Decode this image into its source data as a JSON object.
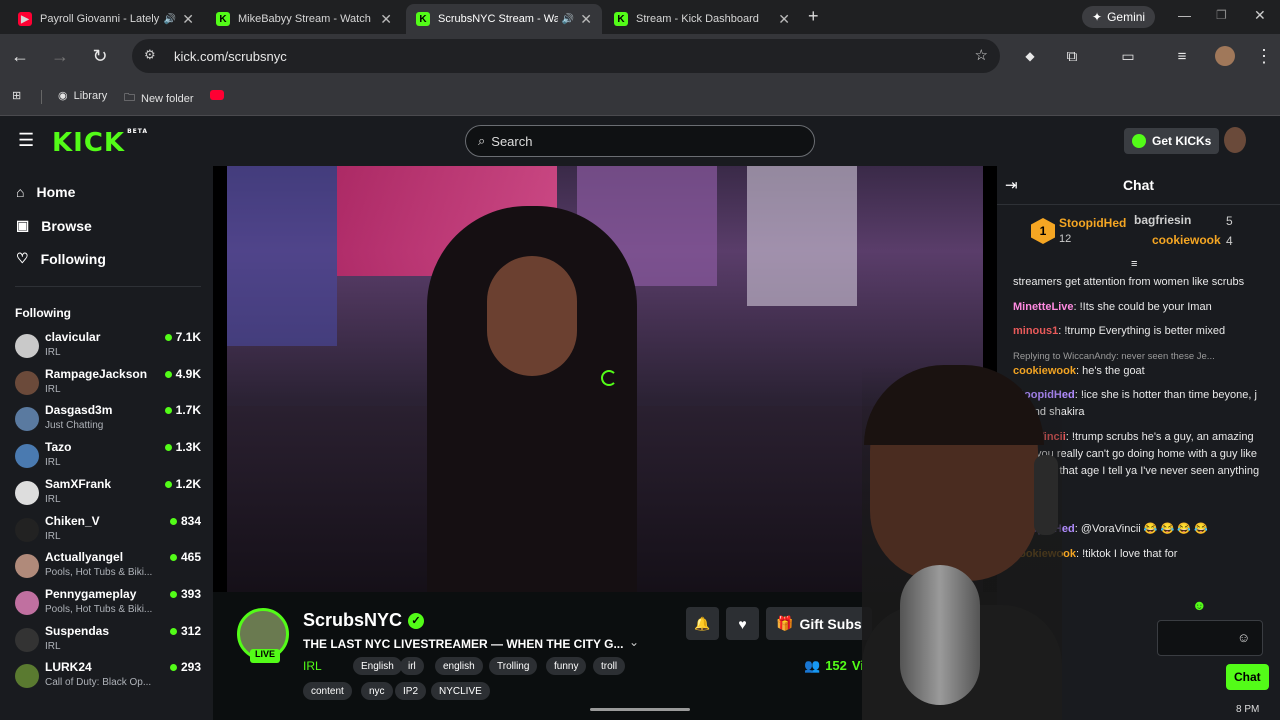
{
  "browser": {
    "tabs": [
      {
        "title": "Payroll Giovanni - Lately",
        "audio": true,
        "favicon_color": "#ff0033"
      },
      {
        "title": "MikeBabyy Stream - Watch L",
        "audio": false,
        "favicon_color": "#53fc18"
      },
      {
        "title": "ScrubsNYC Stream - Wat",
        "audio": true,
        "favicon_color": "#53fc18"
      },
      {
        "title": "Stream - Kick Dashboard",
        "audio": false,
        "favicon_color": "#53fc18"
      }
    ],
    "new_tab": "+",
    "gemini": "Gemini",
    "url": "kick.com/scrubsnyc",
    "bookmarks": [
      "Library",
      "New folder"
    ]
  },
  "kick": {
    "logo": "KICK",
    "logo_badge": "BETA",
    "search_placeholder": "Search",
    "get_kicks": "Get KICKs",
    "nav": [
      "Home",
      "Browse",
      "Following"
    ],
    "following_heading": "Following",
    "following": [
      {
        "name": "clavicular",
        "category": "IRL",
        "viewers": "7.1K",
        "avatar": "#c9c9c9"
      },
      {
        "name": "RampageJackson",
        "category": "IRL",
        "viewers": "4.9K",
        "avatar": "#6b4a3a"
      },
      {
        "name": "Dasgasd3m",
        "category": "Just Chatting",
        "viewers": "1.7K",
        "avatar": "#5a7aa0"
      },
      {
        "name": "Tazo",
        "category": "IRL",
        "viewers": "1.3K",
        "avatar": "#4a7ab0"
      },
      {
        "name": "SamXFrank",
        "category": "IRL",
        "viewers": "1.2K",
        "avatar": "#dddddd"
      },
      {
        "name": "Chiken_V",
        "category": "IRL",
        "viewers": "834",
        "avatar": "#222222"
      },
      {
        "name": "Actuallyangel",
        "category": "Pools, Hot Tubs & Biki...",
        "viewers": "465",
        "avatar": "#b08a7a"
      },
      {
        "name": "Pennygameplay",
        "category": "Pools, Hot Tubs & Biki...",
        "viewers": "393",
        "avatar": "#c070a0"
      },
      {
        "name": "Suspendas",
        "category": "IRL",
        "viewers": "312",
        "avatar": "#333333"
      },
      {
        "name": "LURK24",
        "category": "Call of Duty: Black Op...",
        "viewers": "293",
        "avatar": "#5a7a30"
      }
    ]
  },
  "stream": {
    "channel": "ScrubsNYC",
    "live_badge": "LIVE",
    "title": "THE LAST NYC LIVESTREAMER — WHEN THE CITY G...",
    "category": "IRL",
    "tags": [
      "English",
      "irl",
      "english",
      "Trolling",
      "funny",
      "troll",
      "content",
      "nyc",
      "IP2",
      "NYCLIVE"
    ],
    "gift_subs": "Gift Subs",
    "viewers": "152",
    "viewers_label": "Vie"
  },
  "chat": {
    "title": "Chat",
    "leaders": [
      {
        "name": "StoopidHed",
        "count": "12",
        "rank": "1"
      },
      {
        "name": "bagfriesin",
        "count": "5"
      },
      {
        "name": "cookiewook",
        "count": "4"
      }
    ],
    "messages": [
      {
        "user": "",
        "color": "#e8e8e8",
        "text": "streamers get attention from women like scrubs"
      },
      {
        "user": "MinetteLive",
        "color": "#ff8ae0",
        "text": ": !Its she could be your Iman"
      },
      {
        "user": "minous1",
        "color": "#e85a5a",
        "text": ": !trump Everything is better mixed"
      },
      {
        "user": "",
        "color": "#9a9a9a",
        "text": "Replying to WiccanAndy: never seen these Je..."
      },
      {
        "user": "cookiewook",
        "color": "#f5a623",
        "text": ": he's the goat"
      },
      {
        "user": "StoopidHed",
        "color": "#b18cff",
        "text": ": !ice she is hotter than time beyone, j lo, and shakira"
      },
      {
        "user": "VoraVincii",
        "color": "#e85a5a",
        "text": ": !trump scrubs he's a guy, an amazing guy. you really can't go doing home with a guy like that. And that age I tell ya I've never seen anything like"
      },
      {
        "user": "StoopidHed",
        "color": "#b18cff",
        "text": ": @VoraVincii 😂 😂 😂 😂"
      },
      {
        "user": "cookiewook",
        "color": "#f5a623",
        "text": ": !tiktok I love that for"
      }
    ],
    "send_label": "Chat",
    "clock": "8 PM"
  },
  "colors": {
    "kick_green": "#53fc18",
    "bg": "#0b0e0f",
    "panel": "#191b1f"
  }
}
